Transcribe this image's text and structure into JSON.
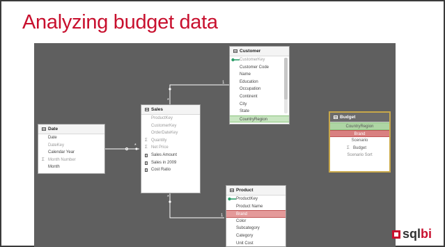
{
  "slide": {
    "title": "Analyzing budget data",
    "accent_color": "#c8102e"
  },
  "tables": {
    "customer": {
      "name": "Customer",
      "fields": [
        "CustomerKey",
        "Customer Code",
        "Name",
        "Education",
        "Occupation",
        "Continent",
        "City",
        "State",
        "CountryRegion"
      ]
    },
    "sales": {
      "name": "Sales",
      "fields": [
        "ProductKey",
        "CustomerKey",
        "OrderDateKey",
        "Quantity",
        "Net Price",
        "Sales Amount",
        "Sales in 2009",
        "Cost Ratio"
      ]
    },
    "date": {
      "name": "Date",
      "fields": [
        "Date",
        "DateKey",
        "Calendar Year",
        "Month Number",
        "Month"
      ]
    },
    "budget": {
      "name": "Budget",
      "fields": [
        "CountryRegion",
        "Brand",
        "Scenario",
        "Budget",
        "Scenario Sort"
      ]
    },
    "product": {
      "name": "Product",
      "fields": [
        "ProductKey",
        "Product Name",
        "Brand",
        "Color",
        "Subcategory",
        "Category",
        "Unit Cost"
      ]
    }
  },
  "relationships": {
    "one_label": "1",
    "many_label": "*"
  },
  "logo": {
    "sq": "sq",
    "l": "l",
    "bi": "bi"
  }
}
